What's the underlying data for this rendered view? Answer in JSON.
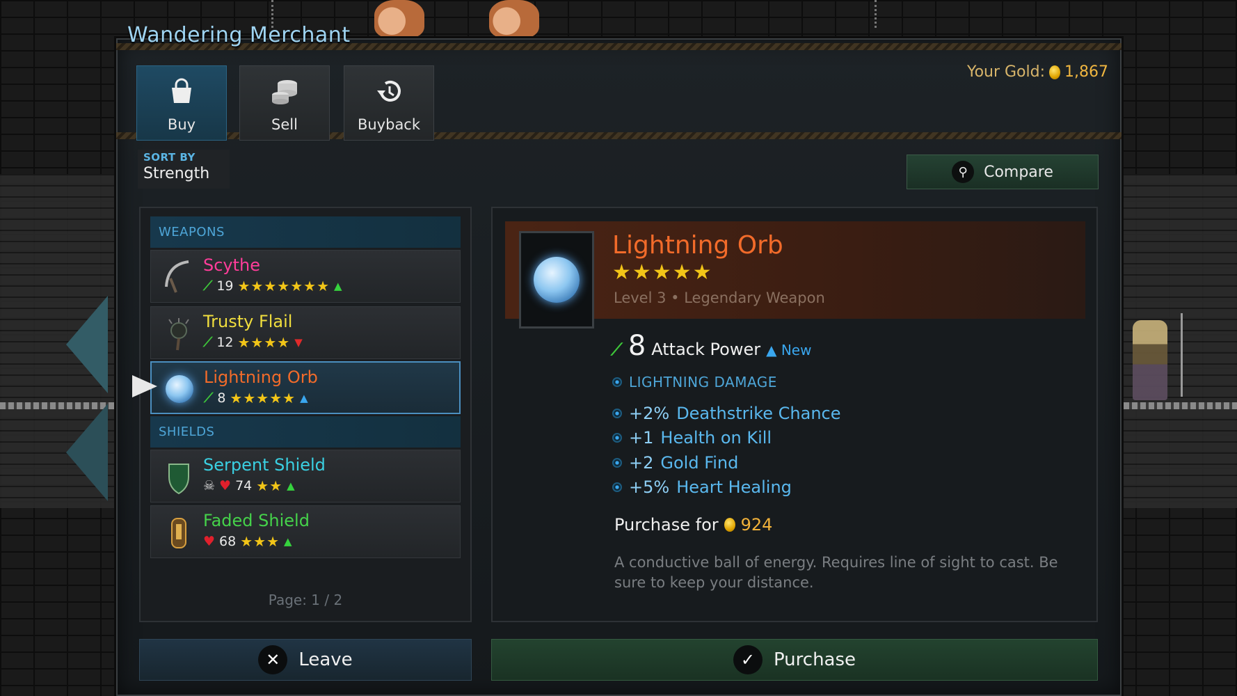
{
  "title": "Wandering Merchant",
  "gold": {
    "label": "Your Gold:",
    "amount": "1,867"
  },
  "tabs": [
    {
      "label": "Buy",
      "icon": "shopping-bag-icon",
      "active": true
    },
    {
      "label": "Sell",
      "icon": "coin-stack-icon",
      "active": false
    },
    {
      "label": "Buyback",
      "icon": "undo-clock-icon",
      "active": false
    }
  ],
  "sort": {
    "label": "SORT BY",
    "value": "Strength"
  },
  "compare": {
    "label": "Compare",
    "icon": "magnifier-icon"
  },
  "categories": {
    "weapons": "WEAPONS",
    "shields": "SHIELDS"
  },
  "items": [
    {
      "name": "Scythe",
      "stat": "19",
      "stars": "★★★★★★★",
      "stars_count": 7,
      "trend": "up",
      "stat_type": "attack",
      "color": "#ff3d9a"
    },
    {
      "name": "Trusty Flail",
      "stat": "12",
      "stars": "★★★★",
      "stars_count": 4,
      "trend": "down",
      "stat_type": "attack",
      "color": "#f0de3e"
    },
    {
      "name": "Lightning Orb",
      "stat": "8",
      "stars": "★★★★★",
      "stars_count": 5,
      "trend": "up-blue",
      "stat_type": "attack",
      "color": "#f26b2a",
      "selected": true
    },
    {
      "name": "Serpent Shield",
      "stat": "74",
      "stars": "★★",
      "stars_count": 2,
      "trend": "up",
      "stat_type": "health",
      "color": "#3ad0e2"
    },
    {
      "name": "Faded Shield",
      "stat": "68",
      "stars": "★★★",
      "stars_count": 3,
      "trend": "up",
      "stat_type": "health",
      "color": "#45d24a"
    }
  ],
  "page": "Page: 1 / 2",
  "detail": {
    "name": "Lightning Orb",
    "stars": "★★★★★",
    "stars_count": 5,
    "subtitle": "Level 3 • Legendary Weapon",
    "attack_value": "8",
    "attack_label": "Attack Power",
    "new_label": "New",
    "damage_type": "LIGHTNING DAMAGE",
    "bonuses": [
      {
        "value": "+2%",
        "label": "Deathstrike Chance"
      },
      {
        "value": "+1",
        "label": "Health on Kill"
      },
      {
        "value": "+2",
        "label": "Gold Find"
      },
      {
        "value": "+5%",
        "label": "Heart Healing"
      }
    ],
    "purchase_label": "Purchase for",
    "price": "924",
    "description": "A conductive ball of energy. Requires line of sight to cast. Be sure to keep your distance."
  },
  "buttons": {
    "leave": "Leave",
    "purchase": "Purchase"
  },
  "colors": {
    "accent_blue": "#4ea6d8",
    "legendary_orange": "#f26b2a",
    "star_gold": "#f2c518",
    "gold_coin": "#f0b640"
  }
}
